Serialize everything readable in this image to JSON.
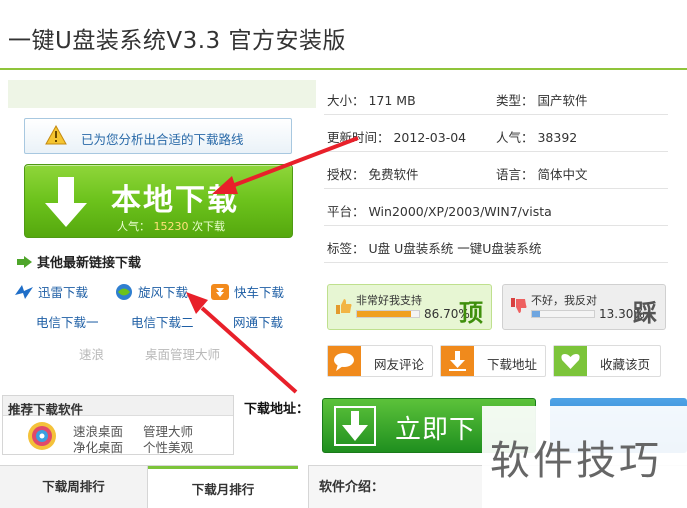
{
  "page": {
    "title": "一键U盘装系统V3.3 官方安装版"
  },
  "left": {
    "notice": "已为您分析出合适的下载路线",
    "download_button": {
      "label": "本地下载",
      "pop_label": "人气：",
      "pop_count": "15230",
      "pop_suffix": "次下载"
    },
    "other_links_title": "其他最新链接下载",
    "links_row1": [
      "迅雷下载",
      "旋风下载",
      "快车下载"
    ],
    "links_row2": [
      "电信下载一",
      "电信下载二",
      "网通下载"
    ],
    "links_row3": [
      "速浪",
      "桌面管理大师"
    ]
  },
  "info": {
    "size": "大小：  171 MB",
    "type": "类型：  国产软件",
    "updated": "更新时间：  2012-03-04",
    "popularity": "人气：  38392",
    "license": "授权：  免费软件",
    "language": "语言：  简体中文",
    "platform": "平台：  Win2000/XP/2003/WIN7/vista",
    "tags": "标签：  U盘   U盘装系统   一键U盘装系统"
  },
  "votes": {
    "good": {
      "label": "非常好我支持",
      "pct": "86.70%",
      "big": "顶",
      "fraction": 0.867
    },
    "bad": {
      "label": "不好，我反对",
      "pct": "13.30%",
      "big": "踩",
      "fraction": 0.133
    }
  },
  "actions": [
    "网友评论",
    "下载地址",
    "收藏该页"
  ],
  "recommend": {
    "title": "推荐下载软件",
    "items": [
      "速浪桌面",
      "管理大师",
      "净化桌面",
      "个性美观"
    ]
  },
  "download_address": {
    "label": "下载地址：",
    "button": "立即下"
  },
  "tabs": [
    "下载周排行",
    "下载月排行"
  ],
  "intro": "软件介绍：",
  "watermark": "软件技巧",
  "colors": {
    "accent_green": "#6cc21c",
    "link_blue": "#1f5fa5",
    "arrow_red": "#e8202a"
  }
}
